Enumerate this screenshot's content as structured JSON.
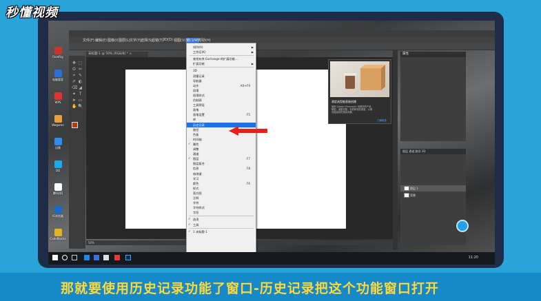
{
  "watermark": {
    "brand": "秒懂视频"
  },
  "subtitle": "那就要使用历史记录功能了窗口-历史记录把这个功能窗口打开",
  "photoshop": {
    "menubar": [
      "文件(F)",
      "编辑(E)",
      "图像(I)",
      "图层(L)",
      "文字(Y)",
      "选择(S)",
      "滤镜(T)",
      "3D(D)",
      "视图(V)",
      "窗口(W)",
      "帮助(H)"
    ],
    "doc_tab": "未标题-1 @ 50% (RGB/8) * ×",
    "status": "50%",
    "window_menu": {
      "items": [
        {
          "label": "排列(A)",
          "submenu": true
        },
        {
          "label": "工作区(K)",
          "submenu": true
        },
        {
          "sep": true
        },
        {
          "label": "查找有关 Exchange 的扩展功能...",
          "submenu": false
        },
        {
          "label": "扩展功能",
          "submenu": true
        },
        {
          "sep": true
        },
        {
          "label": "3D"
        },
        {
          "label": "测量记录"
        },
        {
          "label": "导航器"
        },
        {
          "label": "动作",
          "shortcut": "Alt+F9"
        },
        {
          "label": "段落"
        },
        {
          "label": "段落样式"
        },
        {
          "label": "仿制源"
        },
        {
          "label": "工具预设"
        },
        {
          "label": "画笔"
        },
        {
          "label": "画笔设置",
          "shortcut": "F5"
        },
        {
          "label": "库"
        },
        {
          "label": "历史记录",
          "highlighted": true
        },
        {
          "label": "路径"
        },
        {
          "label": "色板"
        },
        {
          "label": "时间轴"
        },
        {
          "label": "属性",
          "checked": true
        },
        {
          "label": "调整"
        },
        {
          "label": "通道"
        },
        {
          "label": "图层",
          "shortcut": "F7",
          "checked": true
        },
        {
          "label": "图层复合"
        },
        {
          "label": "信息",
          "shortcut": "F8"
        },
        {
          "label": "修改键"
        },
        {
          "label": "学习"
        },
        {
          "label": "颜色",
          "shortcut": "F6"
        },
        {
          "label": "样式"
        },
        {
          "label": "直方图"
        },
        {
          "label": "注释"
        },
        {
          "label": "字符"
        },
        {
          "label": "字符样式"
        },
        {
          "label": "字形"
        },
        {
          "sep": true
        },
        {
          "label": "选项",
          "checked": true
        },
        {
          "label": "工具",
          "checked": true
        },
        {
          "sep": true
        },
        {
          "label": "1 未标题-1",
          "checked": true
        }
      ]
    },
    "tooltip": {
      "title": "测定选型能直接创建",
      "body": "使用 Adobe Dimension 设置您的产品模型，调整光照、材质和相机角度，以便创建逼真的渲染效果。",
      "link": "了解更多"
    },
    "props_panel": {
      "title": "属性"
    },
    "layers_panel": {
      "tabs": "图层  通道  路径  3D",
      "layers": [
        {
          "name": "图层 1"
        },
        {
          "name": "背景"
        }
      ]
    }
  },
  "taskbar": {
    "clock": "11:20"
  },
  "desktop_icons": [
    {
      "label": "FaceRig",
      "color": "#c8352b"
    },
    {
      "label": "电脑管家",
      "color": "#2a6fd6"
    },
    {
      "label": "WPS",
      "color": "#d33"
    },
    {
      "label": "Wegame",
      "color": "#e9a23b"
    },
    {
      "label": "迅雷",
      "color": "#2d8cf0"
    },
    {
      "label": "QQ",
      "color": "#1aabee"
    },
    {
      "label": "腾讯QQ",
      "color": "#ffffff"
    },
    {
      "label": "IE浏览器",
      "color": "#1b6ac9"
    },
    {
      "label": "CodeBlocks",
      "color": "#e6b422"
    }
  ]
}
